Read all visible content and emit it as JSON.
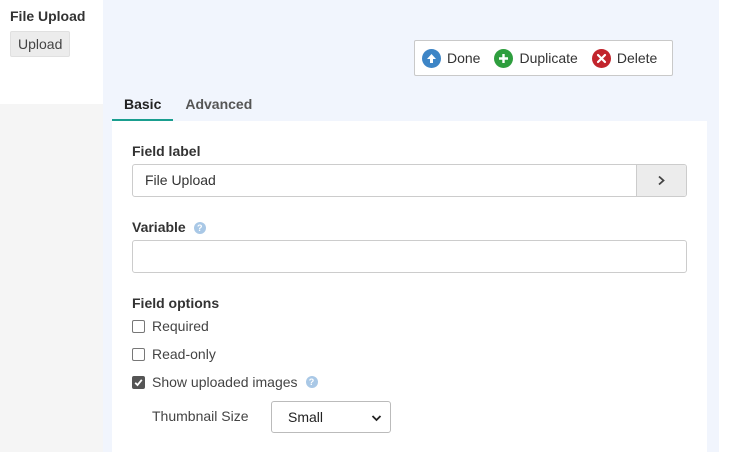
{
  "field": {
    "title": "File Upload",
    "type_chip": "Upload"
  },
  "toolbar": {
    "done_label": "Done",
    "duplicate_label": "Duplicate",
    "delete_label": "Delete"
  },
  "tabs": [
    {
      "label": "Basic",
      "active": true
    },
    {
      "label": "Advanced",
      "active": false
    }
  ],
  "form": {
    "field_label": {
      "label": "Field label",
      "value": "File Upload"
    },
    "variable": {
      "label": "Variable",
      "value": ""
    },
    "field_options": {
      "label": "Field options",
      "options": [
        {
          "label": "Required",
          "checked": false
        },
        {
          "label": "Read-only",
          "checked": false
        },
        {
          "label": "Show uploaded images",
          "checked": true
        }
      ]
    },
    "thumbnail_size": {
      "label": "Thumbnail Size",
      "selected": "Small"
    }
  },
  "colors": {
    "editor_bg": "#f1f5fd",
    "tab_accent": "#1a9e8f",
    "done": "#3d85c6",
    "duplicate": "#2e9e3e",
    "delete": "#c2242c"
  }
}
